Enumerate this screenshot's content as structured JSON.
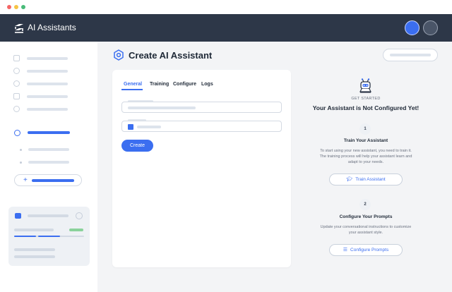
{
  "app": {
    "title": "AI Assistants"
  },
  "page": {
    "title": "Create AI Assistant"
  },
  "tabs": [
    {
      "label": "General",
      "active": true
    },
    {
      "label": "Training",
      "active": false
    },
    {
      "label": "Configure",
      "active": false
    },
    {
      "label": "Logs",
      "active": false
    }
  ],
  "form": {
    "create_label": "Create",
    "color_accent": "#3b6ef0"
  },
  "get_started": {
    "eyebrow": "GET STARTED",
    "heading": "Your Assistant is Not Configured Yet!",
    "steps": [
      {
        "number": "1",
        "title": "Train Your Assistant",
        "description": "To start using your new assistant, you need to train it. The training process will help your assistant learn and adapt to your needs.",
        "button_label": "Train Assistant",
        "button_icon": "graduation-cap-icon"
      },
      {
        "number": "2",
        "title": "Configure Your Prompts",
        "description": "Update your conversational instructions to customize your assistant style.",
        "button_label": "Configure Prompts",
        "button_icon": "sliders-icon"
      }
    ]
  },
  "colors": {
    "accent": "#3b6ef0",
    "topbar": "#2d3748",
    "background": "#f3f4f6"
  }
}
